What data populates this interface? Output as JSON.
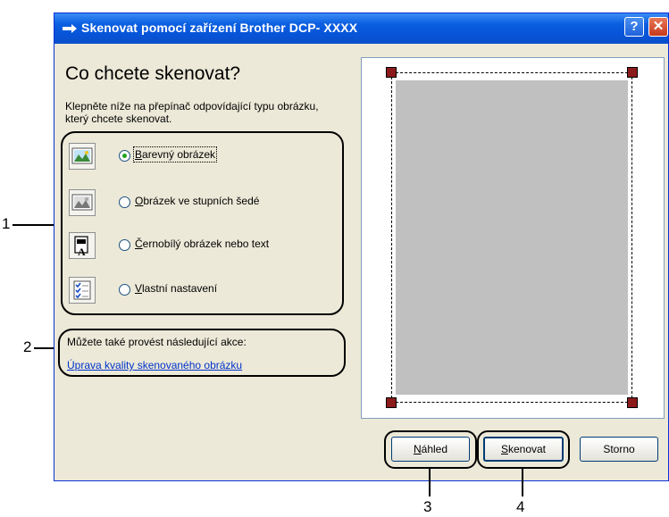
{
  "window": {
    "title": "Skenovat pomocí zařízení Brother DCP- XXXX",
    "help_label": "?",
    "close_label": "✕"
  },
  "heading": "Co chcete skenovat?",
  "description": "Klepněte níže na přepínač odpovídající typu obrázku, který chcete skenovat.",
  "options": [
    {
      "mnemonic": "B",
      "rest": "arevný obrázek",
      "selected": true,
      "icon": "color-photo-icon"
    },
    {
      "mnemonic": "O",
      "rest": "brázek ve stupních šedé",
      "selected": false,
      "icon": "grayscale-photo-icon"
    },
    {
      "mnemonic": "Č",
      "rest": "ernobílý obrázek nebo text",
      "selected": false,
      "icon": "text-document-icon"
    },
    {
      "mnemonic": "V",
      "rest": "lastní nastavení",
      "selected": false,
      "icon": "custom-settings-icon"
    }
  ],
  "also_text": "Můžete také provést následující akce:",
  "link_text": "Úprava kvality skenovaného obrázku",
  "buttons": {
    "preview": {
      "mnemonic": "N",
      "rest": "áhled"
    },
    "scan": {
      "mnemonic": "S",
      "rest": "kenovat"
    },
    "cancel": "Storno"
  },
  "callouts": [
    "1",
    "2",
    "3",
    "4"
  ],
  "colors": {
    "titlebar": "#0754d8",
    "dialog_bg": "#ece9d8",
    "preview_fill": "#c0c0c0",
    "crop_handle": "#8b1a1a",
    "link": "#0033cc"
  }
}
